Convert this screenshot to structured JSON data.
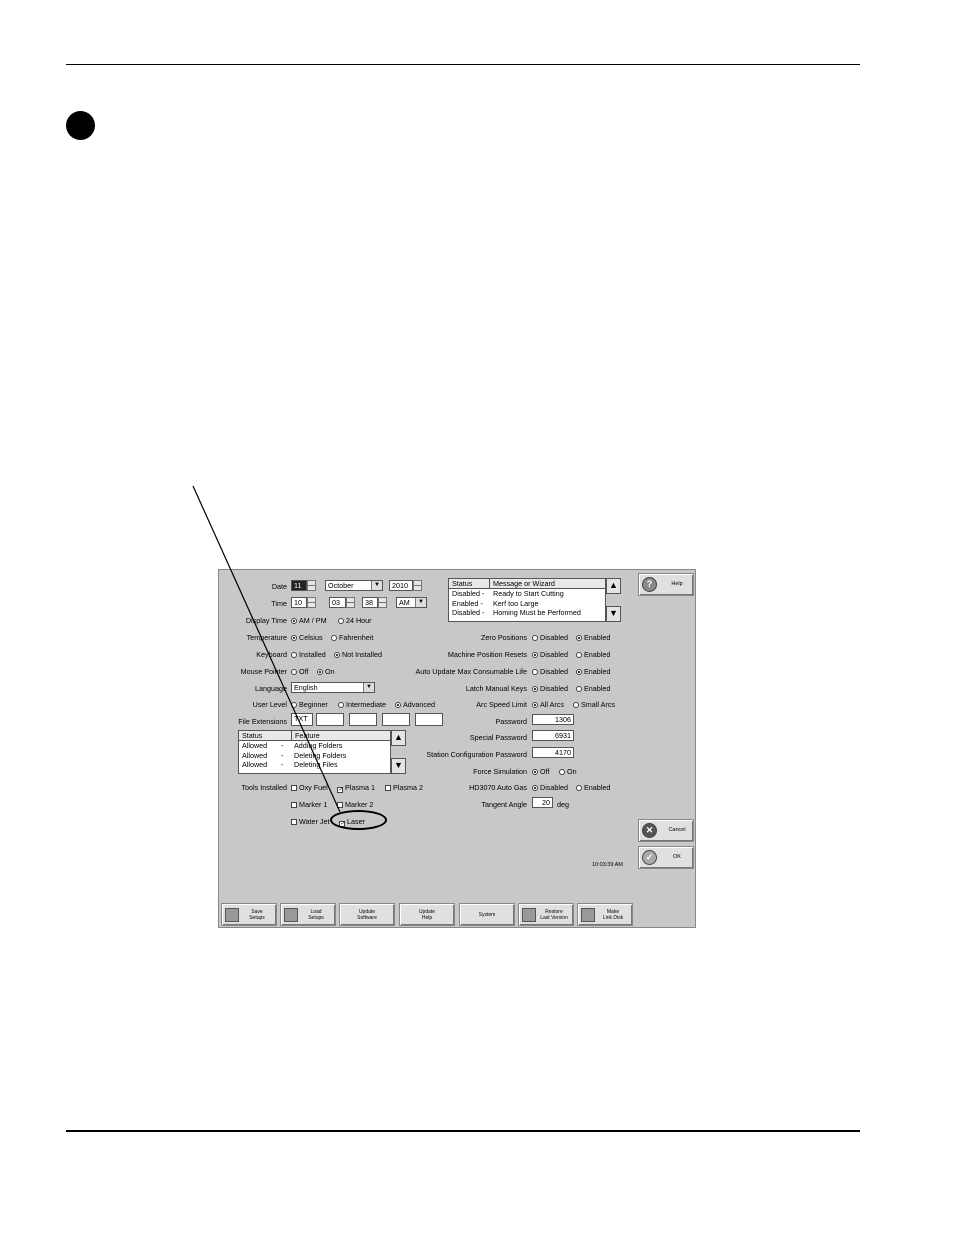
{
  "screen": {
    "date": {
      "label": "Date",
      "day": "11",
      "month": "October",
      "year": "2010"
    },
    "time": {
      "label": "Time",
      "hour": "10",
      "minute": "03",
      "second": "38",
      "ampm": "AM"
    },
    "display_time": {
      "label": "Display Time",
      "opt1": "AM / PM",
      "opt2": "24 Hour"
    },
    "temperature": {
      "label": "Temperature",
      "opt1": "Celsius",
      "opt2": "Fahrenheit"
    },
    "keyboard": {
      "label": "Keyboard",
      "opt1": "Installed",
      "opt2": "Not Installed"
    },
    "mouse_pointer": {
      "label": "Mouse Pointer",
      "opt1": "Off",
      "opt2": "On"
    },
    "language": {
      "label": "Language",
      "value": "English"
    },
    "user_level": {
      "label": "User Level",
      "opt1": "Beginner",
      "opt2": "Intermediate",
      "opt3": "Advanced"
    },
    "file_extensions": {
      "label": "File Extensions",
      "value": "TXT"
    },
    "feature_list": {
      "headers": [
        "Status",
        "Feature"
      ],
      "rows": [
        {
          "status": "Allowed",
          "sep": "-",
          "feature": "Adding Folders"
        },
        {
          "status": "Allowed",
          "sep": "-",
          "feature": "Deleting Folders"
        },
        {
          "status": "Allowed",
          "sep": "-",
          "feature": "Deleting Files"
        }
      ]
    },
    "tools_installed": {
      "label": "Tools Installed",
      "oxy_fuel": "Oxy Fuel",
      "plasma1": "Plasma 1",
      "plasma2": "Plasma 2",
      "marker1": "Marker 1",
      "marker2": "Marker 2",
      "water_jet": "Water Jet",
      "laser": "Laser"
    },
    "message_list": {
      "headers": [
        "Status",
        "Message or Wizard"
      ],
      "rows": [
        {
          "status": "Disabled -",
          "message": "Ready to Start Cutting"
        },
        {
          "status": "Enabled -",
          "message": "Kerf too Large"
        },
        {
          "status": "Disabled -",
          "message": "Homing Must be Performed"
        }
      ]
    },
    "zero_positions": {
      "label": "Zero Positions",
      "opt1": "Disabled",
      "opt2": "Enabled"
    },
    "machine_position_resets": {
      "label": "Machine Position Resets",
      "opt1": "Disabled",
      "opt2": "Enabled"
    },
    "auto_update": {
      "label": "Auto Update Max Consumable Life",
      "opt1": "Disabled",
      "opt2": "Enabled"
    },
    "latch_manual_keys": {
      "label": "Latch Manual Keys",
      "opt1": "Disabled",
      "opt2": "Enabled"
    },
    "arc_speed_limit": {
      "label": "Arc Speed Limit",
      "opt1": "All Arcs",
      "opt2": "Small Arcs"
    },
    "password": {
      "label": "Password",
      "value": "1306"
    },
    "special_password": {
      "label": "Special Password",
      "value": "6931"
    },
    "station_password": {
      "label": "Station Configuration Password",
      "value": "4170"
    },
    "force_simulation": {
      "label": "Force Simulation",
      "opt1": "Off",
      "opt2": "On"
    },
    "hd3070": {
      "label": "HD3070 Auto Gas",
      "opt1": "Disabled",
      "opt2": "Enabled"
    },
    "tangent_angle": {
      "label": "Tangent Angle",
      "value": "20",
      "unit": "deg"
    },
    "clock": "10:03:39 AM",
    "help_label": "Help",
    "cancel_label": "Cancel",
    "ok_label": "OK",
    "toolbar": {
      "save": "Save\nSetups",
      "load": "Load\nSetups",
      "update_software": "Update\nSoftware",
      "update_help": "Update\nHelp",
      "system": "System",
      "restore": "Restore\nLast Version",
      "make_link": "Make\nLink Disk"
    }
  }
}
